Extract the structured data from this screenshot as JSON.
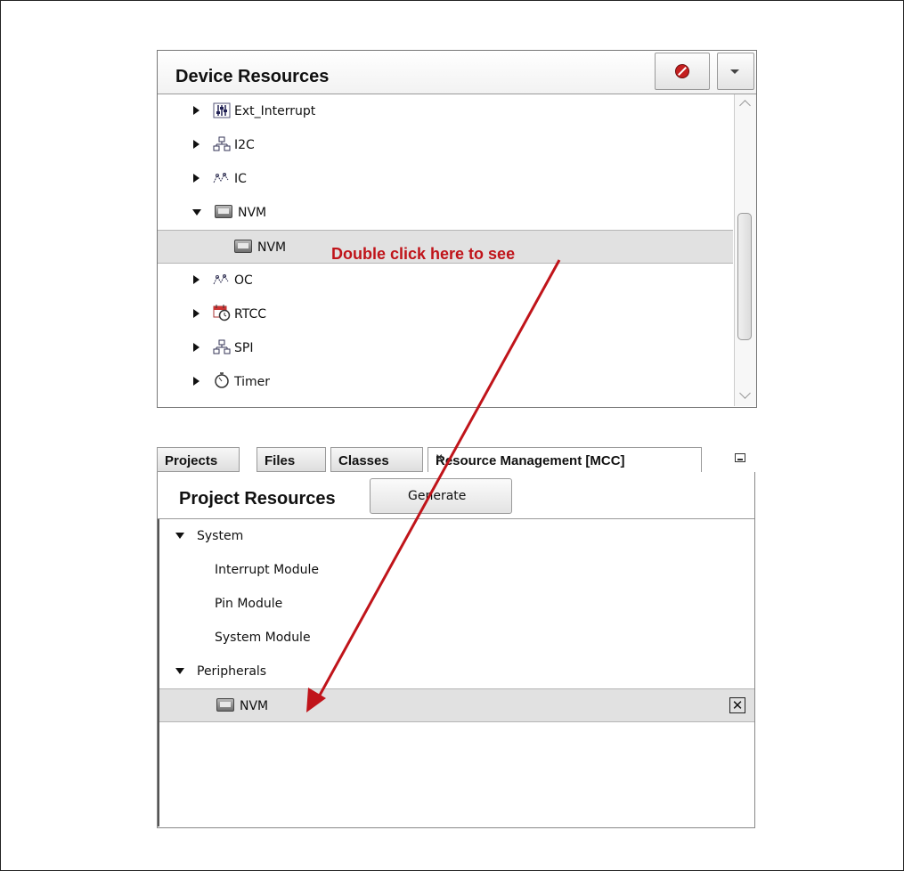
{
  "device_resources": {
    "title": "Device Resources",
    "items": [
      {
        "label": "Ext_Interrupt",
        "icon": "sliders-icon",
        "expanded": false
      },
      {
        "label": "I2C",
        "icon": "network-icon",
        "expanded": false
      },
      {
        "label": "IC",
        "icon": "waveform-icon",
        "expanded": false
      },
      {
        "label": "NVM",
        "icon": "chip-icon",
        "expanded": true
      },
      {
        "label": "NVM",
        "icon": "chip-icon",
        "child": true,
        "selected": true
      },
      {
        "label": "OC",
        "icon": "waveform-icon",
        "expanded": false
      },
      {
        "label": "RTCC",
        "icon": "calendar-clock-icon",
        "expanded": false
      },
      {
        "label": "SPI",
        "icon": "network-icon",
        "expanded": false
      },
      {
        "label": "Timer",
        "icon": "stopwatch-icon",
        "expanded": false
      }
    ]
  },
  "annotation": {
    "text": "Double click here to see",
    "color": "#c0141a"
  },
  "tabs": [
    {
      "label": "Projects",
      "active": false
    },
    {
      "label": "Files",
      "active": false
    },
    {
      "label": "Classes",
      "active": false
    },
    {
      "label": "Resource Management [MCC]",
      "active": true
    }
  ],
  "project_resources": {
    "title": "Project Resources",
    "generate_label": "Generate",
    "items": [
      {
        "label": "System",
        "group": true
      },
      {
        "label": "Interrupt Module"
      },
      {
        "label": "Pin Module"
      },
      {
        "label": "System Module"
      },
      {
        "label": "Peripherals",
        "group": true
      },
      {
        "label": "NVM",
        "icon": "chip-icon",
        "selected": true
      }
    ],
    "remove_glyph": "✕"
  }
}
